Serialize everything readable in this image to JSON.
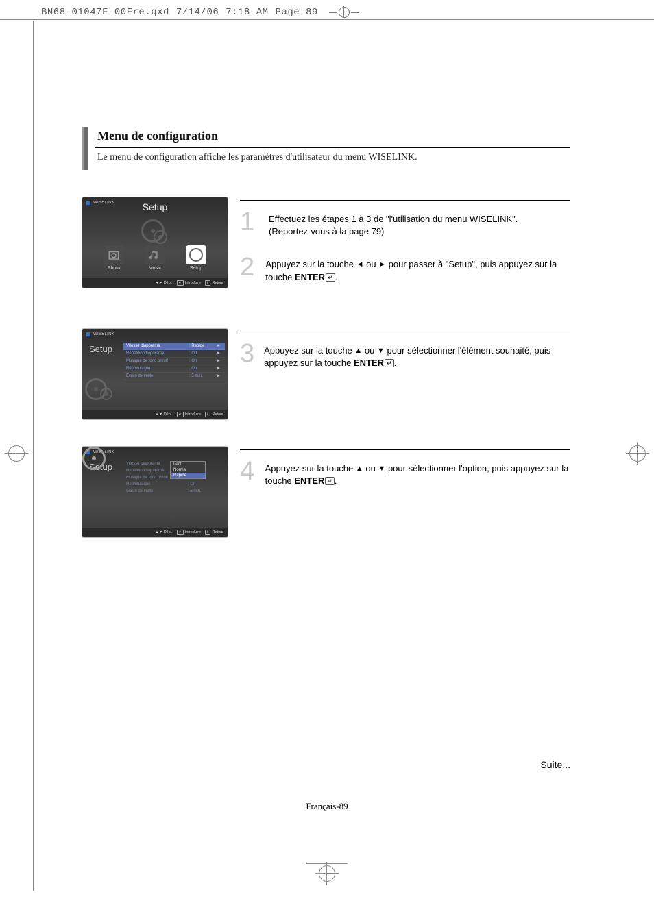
{
  "slug": {
    "filename": "BN68-01047F-00Fre.qxd",
    "date": "7/14/06",
    "time": "7:18 AM",
    "page_label": "Page 89"
  },
  "section": {
    "title": "Menu de configuration",
    "subtitle": "Le menu de configuration affiche les paramètres d'utilisateur du menu WISELINK."
  },
  "steps": {
    "s1": {
      "num": "1",
      "text_a": "Effectuez les étapes 1 à 3 de \"l'utilisation du menu WISELINK\".",
      "text_b": "(Reportez-vous à la page 79)"
    },
    "s2": {
      "num": "2",
      "text_a": "Appuyez sur la touche ",
      "text_b": " ou ",
      "text_c": " pour passer à \"Setup\", puis appuyez sur la touche ",
      "enter": "ENTER",
      "text_d": "."
    },
    "s3": {
      "num": "3",
      "text_a": "Appuyez sur la touche ",
      "text_b": " ou ",
      "text_c": " pour sélectionner l'élément souhaité, puis appuyez sur la touche ",
      "enter": "ENTER",
      "text_d": "."
    },
    "s4": {
      "num": "4",
      "text_a": "Appuyez sur la touche ",
      "text_b": " ou ",
      "text_c": " pour sélectionner l'option, puis appuyez sur la touche ",
      "enter": "ENTER",
      "text_d": "."
    }
  },
  "tv_common": {
    "brand": "WISELINK",
    "footer_move_lr": "◄► Dépl.",
    "footer_move_ud": "▲▼ Dépl.",
    "footer_enter": "Introduire",
    "footer_return": "Retour",
    "setup_label": "Setup"
  },
  "tv1": {
    "icons": [
      {
        "label": "Photo"
      },
      {
        "label": "Music"
      },
      {
        "label": "Setup"
      }
    ]
  },
  "tv2": {
    "rows": [
      {
        "label": "Vitesse diaporama",
        "value": "Rapide",
        "hl": true
      },
      {
        "label": "Répétitiondiaporama",
        "value": "Off",
        "hl": false
      },
      {
        "label": "Musique de fond on/off",
        "value": "On",
        "hl": false
      },
      {
        "label": "Rép/musique",
        "value": "On",
        "hl": false
      },
      {
        "label": "Écran de veille",
        "value": "5 min.",
        "hl": false
      }
    ]
  },
  "tv3": {
    "rows": [
      {
        "label": "Vitesse diaporama",
        "value": "Lent"
      },
      {
        "label": "Répétitiondiaporama",
        "value": "Normal"
      },
      {
        "label": "Musique de fond on/off",
        "value": "Rapide"
      },
      {
        "label": "Rép/musique",
        "value": "On"
      },
      {
        "label": "Écran de veille",
        "value": "5 min."
      }
    ],
    "dropdown": {
      "options": [
        "Lent",
        "Normal",
        "Rapide"
      ],
      "selected": "Rapide"
    }
  },
  "footer": {
    "page": "Français-89",
    "continuation": "Suite..."
  }
}
